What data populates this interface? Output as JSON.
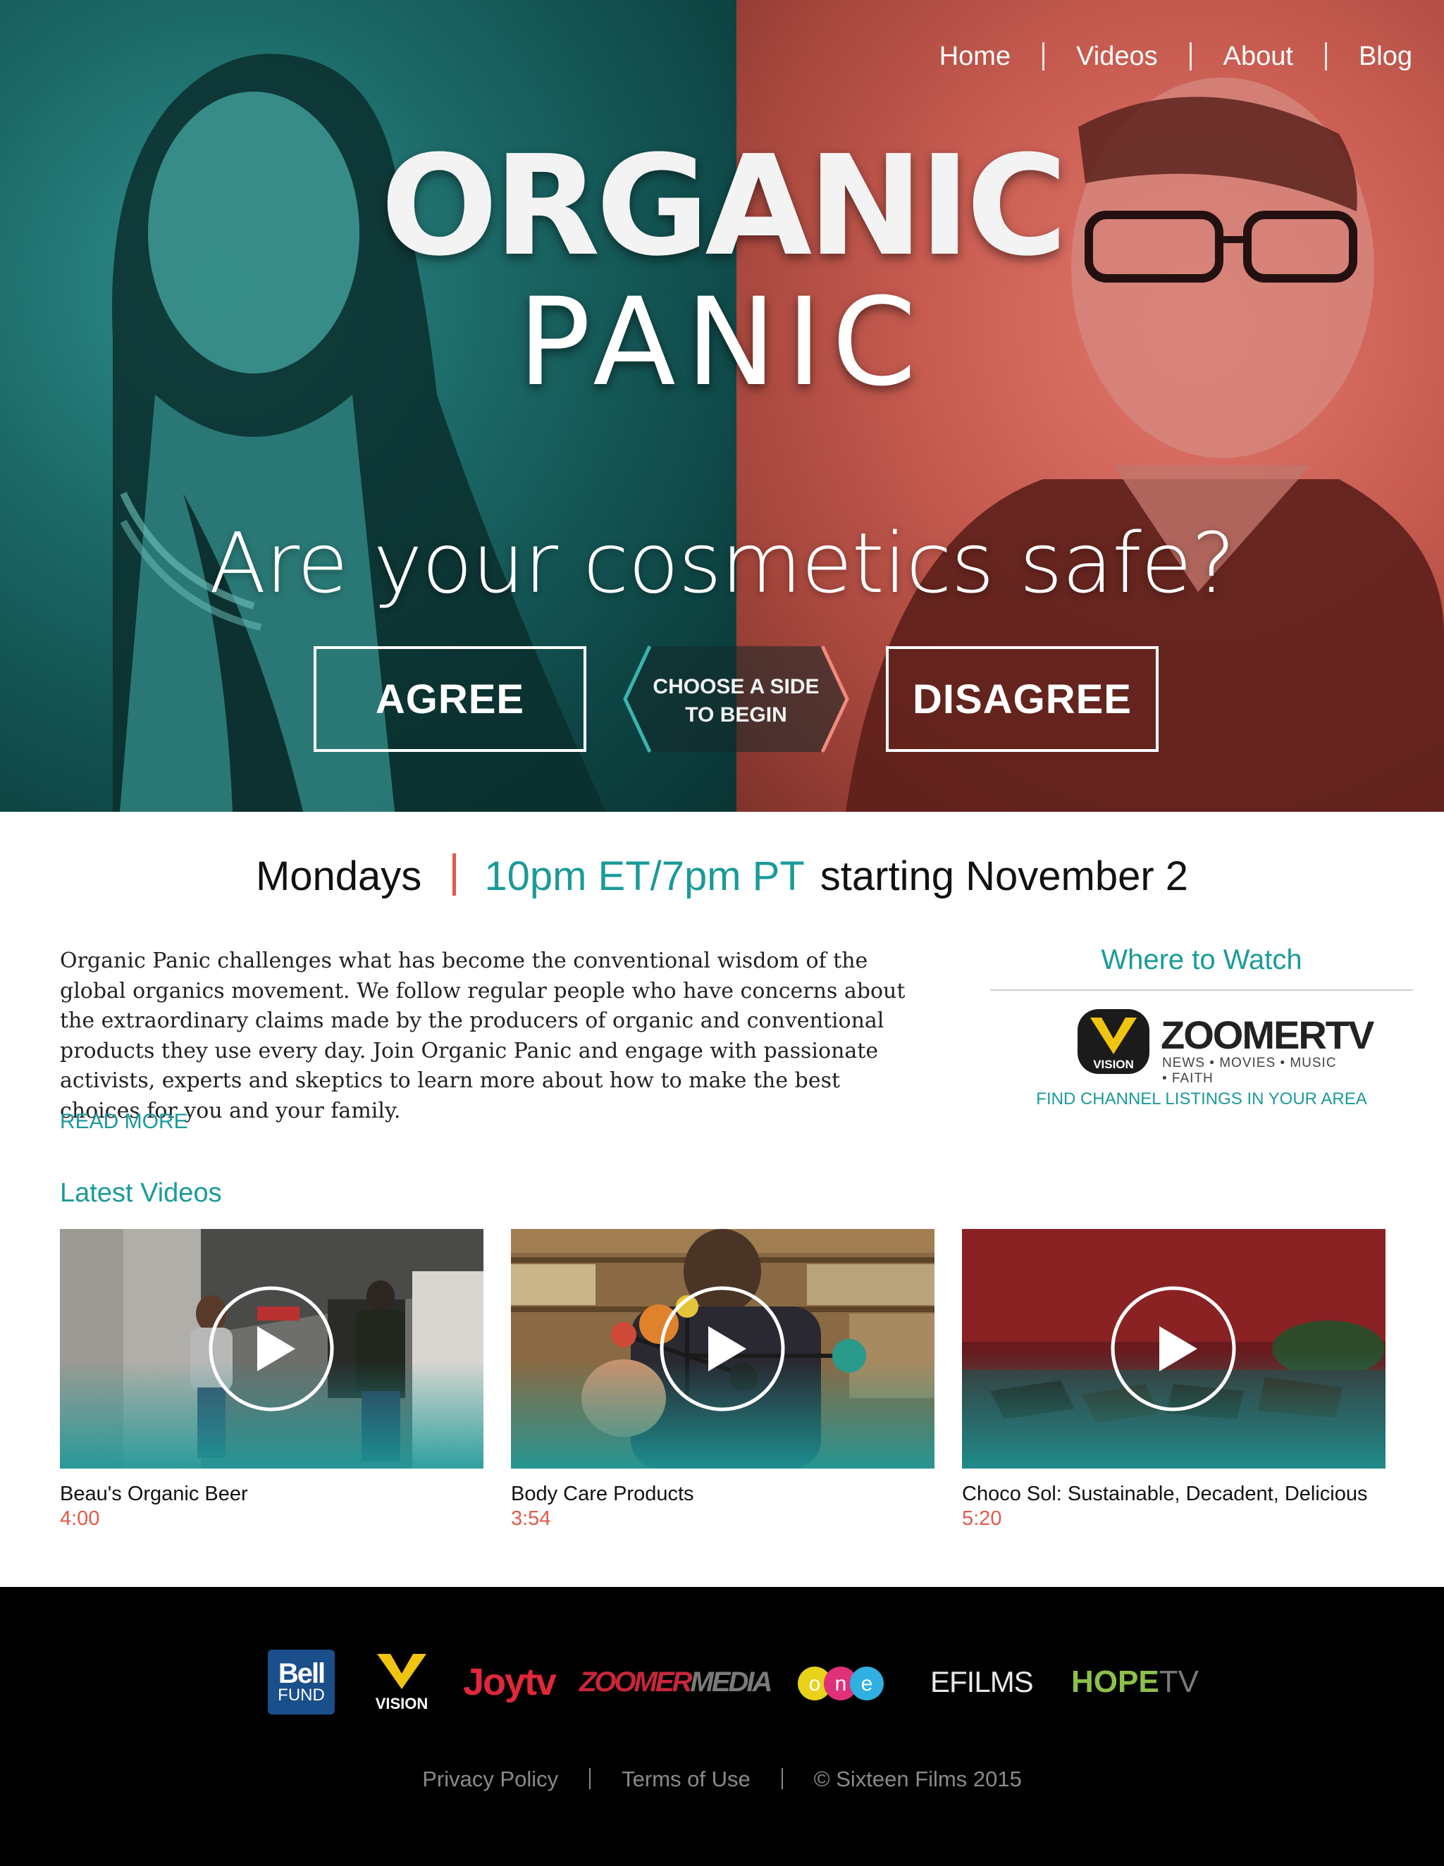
{
  "nav": {
    "items": [
      "Home",
      "Videos",
      "About",
      "Blog"
    ]
  },
  "hero": {
    "logo_line1": "ORGANIC",
    "logo_line2": "PANIC",
    "tagline": "Are your cosmetics safe?",
    "agree_label": "AGREE",
    "disagree_label": "DISAGREE",
    "choose_line1": "CHOOSE A SIDE",
    "choose_line2": "TO BEGIN"
  },
  "schedule": {
    "day": "Mondays",
    "time": "10pm ET/7pm PT",
    "start": "starting November 2"
  },
  "description": {
    "text": "Organic Panic challenges what has become the conventional wisdom of the global organics movement. We follow regular people who have concerns about the extraordinary claims made by the producers of organic and conventional products they use every day. Join Organic Panic and engage with passionate activists, experts and skeptics to learn more about how to make the best choices for you and your family.",
    "read_more": "READ MORE"
  },
  "where_to_watch": {
    "title": "Where to Watch",
    "channel_name": "ZOOMERTV",
    "channel_tagline": "NEWS • MOVIES • MUSIC • FAITH",
    "channel_badge": "VISION",
    "find_link": "FIND CHANNEL LISTINGS IN YOUR AREA"
  },
  "videos": {
    "heading": "Latest Videos",
    "items": [
      {
        "title": "Beau's Organic Beer",
        "duration": "4:00"
      },
      {
        "title": "Body Care Products",
        "duration": "3:54"
      },
      {
        "title": "Choco Sol: Sustainable, Decadent, Delicious",
        "duration": "5:20"
      }
    ]
  },
  "footer": {
    "partners": {
      "bell_1": "Bell",
      "bell_2": "FUND",
      "vision": "VISION",
      "joytv": "Joytv",
      "zoomer": "ZOOMER",
      "media": "MEDIA",
      "one": "one",
      "efilms": "EFILMS",
      "hope": "HOPE",
      "tv": "TV"
    },
    "privacy": "Privacy Policy",
    "terms": "Terms of Use",
    "copyright": "© Sixteen Films 2015"
  },
  "colors": {
    "teal": "#1b9a9a",
    "coral": "#e25a4b",
    "footer_bg": "#000000"
  }
}
